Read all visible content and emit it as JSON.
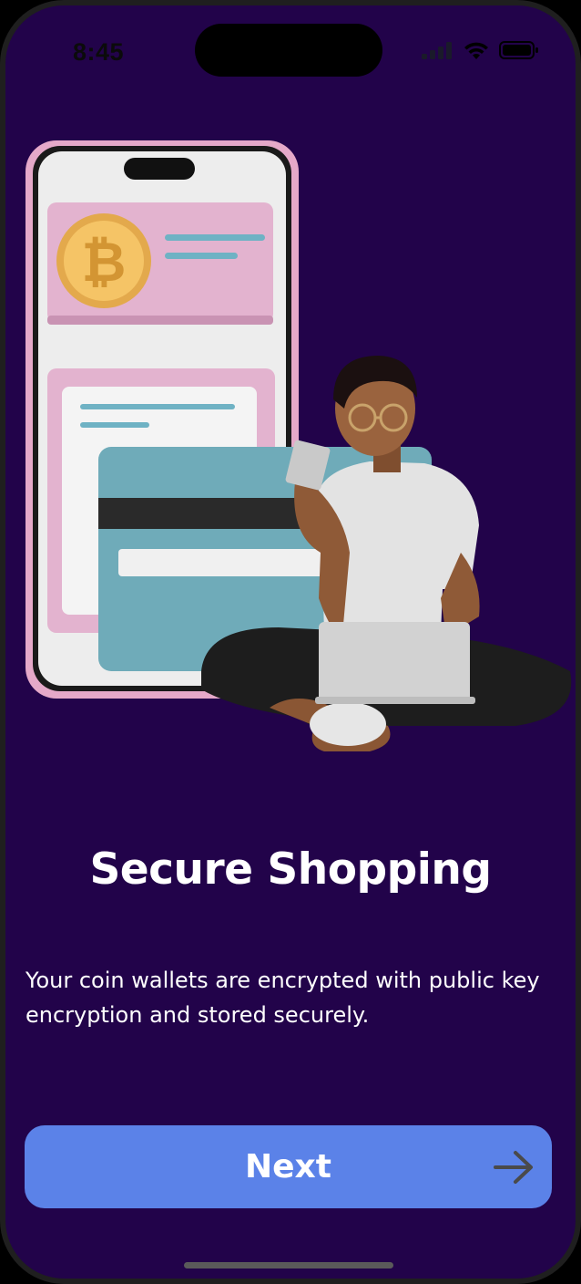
{
  "status_bar": {
    "time": "8:45",
    "icons": [
      "signal-icon",
      "wifi-icon",
      "battery-icon"
    ]
  },
  "illustration": {
    "subject": "person-with-card-and-laptop",
    "elements": [
      "phone-mockup",
      "bitcoin-coin",
      "credit-card"
    ]
  },
  "onboarding": {
    "title": "Secure Shopping",
    "description": "Your coin wallets are encrypted with public key encryption and stored securely."
  },
  "actions": {
    "next_label": "Next",
    "next_icon": "arrow-right-icon"
  },
  "colors": {
    "background": "#22034a",
    "button": "#5b82e8",
    "text": "#ffffff"
  }
}
